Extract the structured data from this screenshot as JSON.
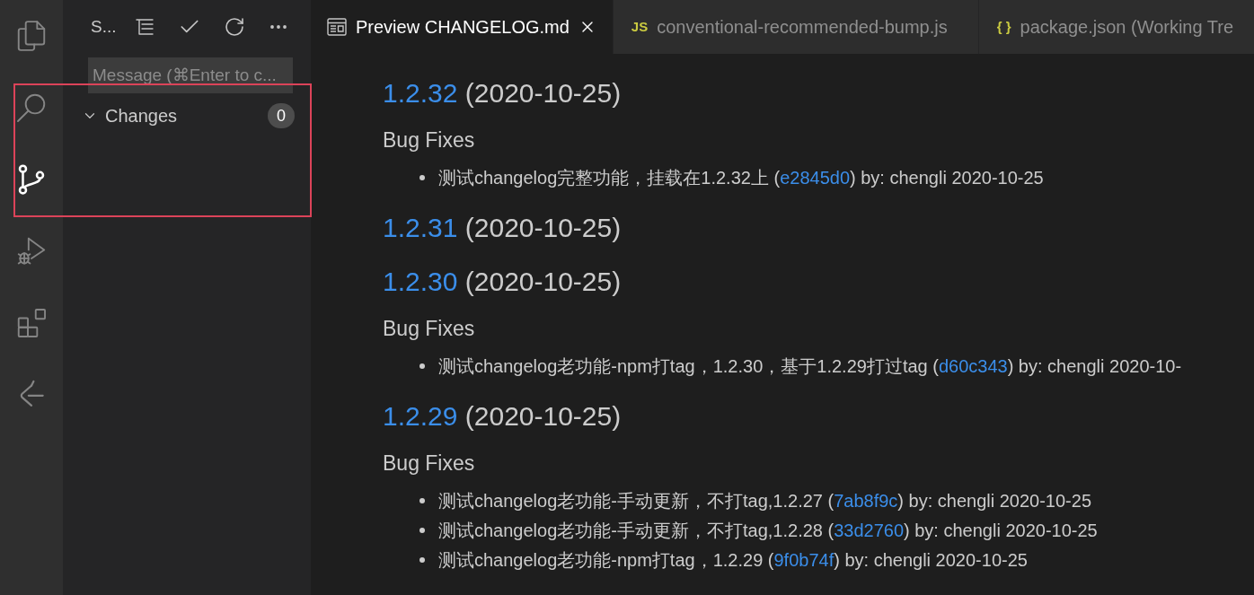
{
  "activity_bar": {
    "items": [
      {
        "kind": "explorer",
        "selected": false
      },
      {
        "kind": "search",
        "selected": false
      },
      {
        "kind": "source_control",
        "selected": true
      },
      {
        "kind": "run_debug",
        "selected": false
      },
      {
        "kind": "extensions",
        "selected": false
      },
      {
        "kind": "remote",
        "selected": false
      }
    ]
  },
  "sidebar": {
    "title": "S...",
    "message": {
      "placeholder": "Message (⌘Enter to c..."
    },
    "changes": {
      "label": "Changes",
      "expanded": true,
      "count": "0"
    }
  },
  "tabs": [
    {
      "kind": "preview",
      "label": "Preview CHANGELOG.md",
      "selected": true
    },
    {
      "kind": "file",
      "file_icon": "JS",
      "label": "conventional-recommended-bump.js",
      "selected": false
    },
    {
      "kind": "file",
      "file_icon": "{ }",
      "label": "package.json (Working Tre",
      "selected": false
    }
  ],
  "preview": {
    "releases": [
      {
        "version": "1.2.32",
        "date": "(2020-10-25)",
        "sections": [
          {
            "title": "Bug Fixes",
            "items": [
              {
                "text": "测试changelog完整功能，挂载在1.2.32上 (",
                "commit": "e2845d0",
                "tail": ") by: chengli 2020-10-25"
              }
            ]
          }
        ]
      },
      {
        "version": "1.2.31",
        "date": "(2020-10-25)"
      },
      {
        "version": "1.2.30",
        "date": "(2020-10-25)",
        "sections": [
          {
            "title": "Bug Fixes",
            "items": [
              {
                "text": "测试changelog老功能-npm打tag，1.2.30，基于1.2.29打过tag (",
                "commit": "d60c343",
                "tail": ") by: chengli 2020-10-"
              }
            ]
          }
        ]
      },
      {
        "version": "1.2.29",
        "date": "(2020-10-25)",
        "sections": [
          {
            "title": "Bug Fixes",
            "items": [
              {
                "text": "测试changelog老功能-手动更新，不打tag,1.2.27 (",
                "commit": "7ab8f9c",
                "tail": ") by: chengli 2020-10-25"
              },
              {
                "text": "测试changelog老功能-手动更新，不打tag,1.2.28 (",
                "commit": "33d2760",
                "tail": ") by: chengli 2020-10-25"
              },
              {
                "text": "测试changelog老功能-npm打tag，1.2.29 (",
                "commit": "9f0b74f",
                "tail": ") by: chengli 2020-10-25"
              }
            ]
          }
        ]
      }
    ]
  }
}
